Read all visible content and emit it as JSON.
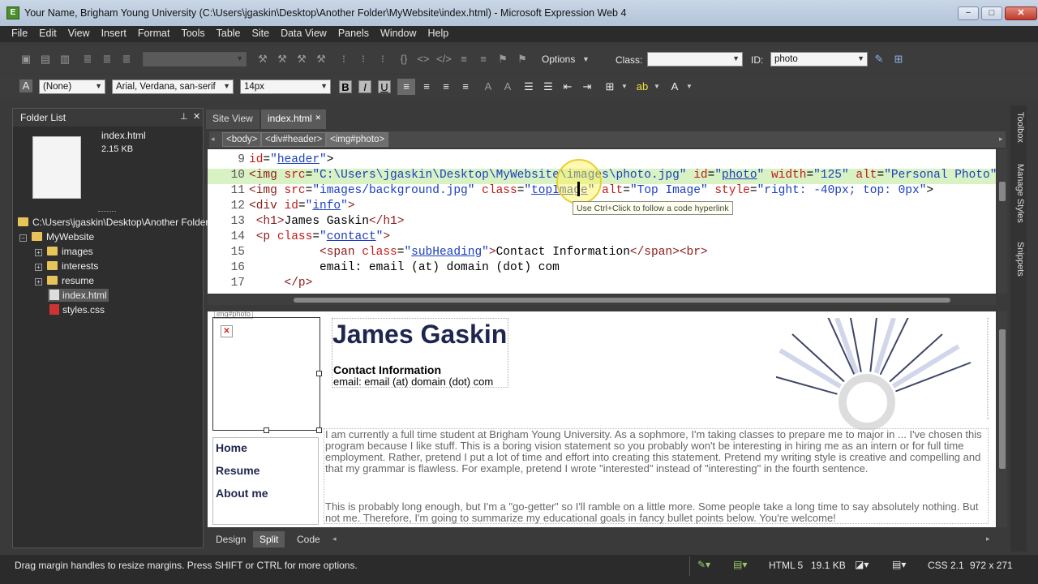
{
  "window": {
    "title": "Your Name, Brigham Young University (C:\\Users\\jgaskin\\Desktop\\Another Folder\\MyWebsite\\index.html) - Microsoft Expression Web 4",
    "minimize": "−",
    "maximize": "□",
    "close": "✕"
  },
  "menu": [
    "File",
    "Edit",
    "View",
    "Insert",
    "Format",
    "Tools",
    "Table",
    "Site",
    "Data View",
    "Panels",
    "Window",
    "Help"
  ],
  "toolbar1": {
    "options_label": "Options",
    "class_label": "Class:",
    "class_value": "",
    "id_label": "ID:",
    "id_value": "photo"
  },
  "toolbar2": {
    "style_value": "(None)",
    "font_value": "Arial, Verdana, san-serif",
    "size_value": "14px",
    "bold": "B",
    "italic": "I",
    "underline": "U"
  },
  "folder_list": {
    "title": "Folder List",
    "preview_name": "index.html",
    "preview_size": "2.15 KB",
    "root": "C:\\Users\\jgaskin\\Desktop\\Another Folder",
    "site": "MyWebsite",
    "folders": [
      "images",
      "interests",
      "resume"
    ],
    "files": [
      "index.html",
      "styles.css"
    ]
  },
  "tabs": [
    "Site View",
    "index.html"
  ],
  "breadcrumbs": [
    "<body>",
    "<div#header>",
    "<img#photo>"
  ],
  "code": {
    "line_numbers": [
      "9",
      "10",
      "11",
      "12",
      "13",
      "14",
      "15",
      "16",
      "17"
    ],
    "tooltip": "Use Ctrl+Click to follow a code hyperlink"
  },
  "design": {
    "tag_label": "img#photo",
    "heading": "James Gaskin",
    "contact_title": "Contact Information",
    "contact_email": "email: email (at) domain (dot) com",
    "nav": [
      "Home",
      "Resume",
      "About me"
    ],
    "para1": "I am currently a full time student at Brigham Young University. As a sophmore, I'm taking classes to prepare me to major in ... I've chosen this program because I like stuff. This is a boring vision statement so you probably won't be interesting in hiring me as an intern or for full time employment. Rather, pretend I put a lot of time and effort into creating this statement. Pretend my writing style is creative and compelling and that my grammar is flawless. For example, pretend I wrote \"interested\" instead of \"interesting\" in the fourth sentence.",
    "para2": "This is probably long enough, but I'm a \"go-getter\" so I'll ramble on a little more. Some people take a long time to say absolutely nothing. But not me. Therefore, I'm going to summarize my educational goals in fancy bullet points below. You're welcome!"
  },
  "view_tabs": [
    "Design",
    "Split",
    "Code"
  ],
  "status": {
    "message": "Drag margin handles to resize margins. Press SHIFT or CTRL for more options.",
    "doctype": "HTML 5",
    "filesize": "19.1 KB",
    "css": "CSS 2.1",
    "dimensions": "972 x 271"
  },
  "right_panels": [
    "Toolbox",
    "Manage Styles",
    "Snippets"
  ]
}
